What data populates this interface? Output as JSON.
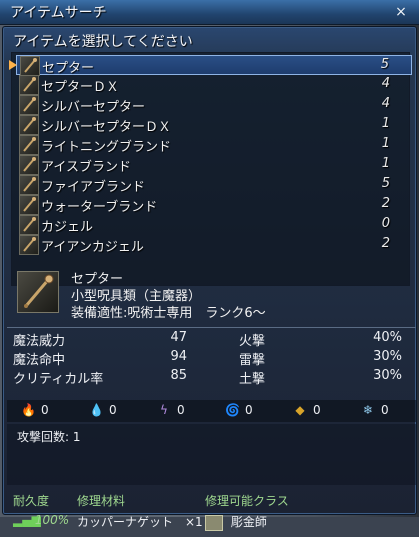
{
  "window": {
    "title": "アイテムサーチ",
    "close_glyph": "×"
  },
  "prompt": "アイテムを選択してください",
  "items": [
    {
      "name": "セプター",
      "qty": "5",
      "selected": true
    },
    {
      "name": "セプターＤＸ",
      "qty": "4"
    },
    {
      "name": "シルバーセプター",
      "qty": "4"
    },
    {
      "name": "シルバーセプターＤＸ",
      "qty": "1"
    },
    {
      "name": "ライトニングブランド",
      "qty": "1"
    },
    {
      "name": "アイスブランド",
      "qty": "1"
    },
    {
      "name": "ファイアブランド",
      "qty": "5"
    },
    {
      "name": "ウォーターブランド",
      "qty": "2"
    },
    {
      "name": "カジェル",
      "qty": "0"
    },
    {
      "name": "アイアンカジェル",
      "qty": "2"
    }
  ],
  "detail": {
    "name": "セプター",
    "category": "小型呪具類（主魔器）",
    "equip": "装備適性:呪術士専用　ランク6～",
    "icon": "scepter-icon"
  },
  "stats": {
    "left": [
      {
        "label": "魔法威力",
        "value": "47"
      },
      {
        "label": "魔法命中",
        "value": "94"
      },
      {
        "label": "クリティカル率",
        "value": "85"
      }
    ],
    "right": [
      {
        "label": "火撃",
        "value": "40%"
      },
      {
        "label": "雷撃",
        "value": "30%"
      },
      {
        "label": "土撃",
        "value": "30%"
      }
    ]
  },
  "resistances": [
    {
      "icon": "fire-icon",
      "glyph": "🔥",
      "value": "0",
      "color": "#e06a2a"
    },
    {
      "icon": "water-icon",
      "glyph": "💧",
      "value": "0",
      "color": "#3f7fd8"
    },
    {
      "icon": "lightning-icon",
      "glyph": "ϟ",
      "value": "0",
      "color": "#b38ce0"
    },
    {
      "icon": "wind-icon",
      "glyph": "🌀",
      "value": "0",
      "color": "#4fb05a"
    },
    {
      "icon": "earth-icon",
      "glyph": "◆",
      "value": "0",
      "color": "#d8a42a"
    },
    {
      "icon": "ice-icon",
      "glyph": "❄",
      "value": "0",
      "color": "#8fc8ea"
    }
  ],
  "attack": {
    "label": "攻撃回数: 1"
  },
  "repair": {
    "durability_header": "耐久度",
    "durability_value": "100%",
    "material_header": "修理材料",
    "material_value": "カッパーナゲット　×1",
    "class_header": "修理可能クラス",
    "class_value": "彫金師"
  }
}
